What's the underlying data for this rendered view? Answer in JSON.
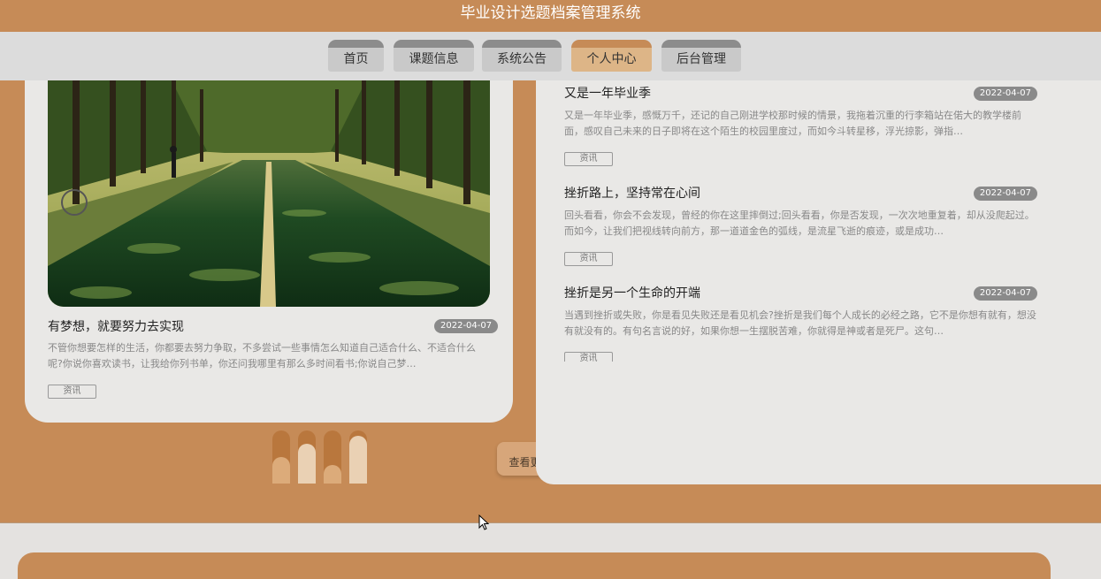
{
  "header": {
    "title": "毕业设计选题档案管理系统"
  },
  "nav": {
    "items": [
      {
        "label": "首页"
      },
      {
        "label": "课题信息"
      },
      {
        "label": "系统公告"
      },
      {
        "label": "个人中心"
      },
      {
        "label": "后台管理"
      }
    ],
    "active_index": 3
  },
  "featured": {
    "title": "有梦想，就要努力去实现",
    "date": "2022-04-07",
    "excerpt": "不管你想要怎样的生活，你都要去努力争取，不多尝试一些事情怎么知道自己适合什么、不适合什么呢?你说你喜欢读书，让我给你列书单，你还问我哪里有那么多时间看书;你说自己梦…",
    "tag": "资讯"
  },
  "news": [
    {
      "title": "又是一年毕业季",
      "date": "2022-04-07",
      "excerpt": "又是一年毕业季，感慨万千，还记的自己刚进学校那时候的情景，我拖着沉重的行李箱站在偌大的教学楼前面，感叹自己未来的日子即将在这个陌生的校园里度过，而如今斗转星移，浮光掠影，弹指…",
      "tag": "资讯"
    },
    {
      "title": "挫折路上，坚持常在心间",
      "date": "2022-04-07",
      "excerpt": "回头看看，你会不会发现，曾经的你在这里摔倒过;回头看看，你是否发现，一次次地重复着，却从没爬起过。而如今，让我们把视线转向前方，那一道道金色的弧线，是流星飞逝的痕迹，或是成功…",
      "tag": "资讯"
    },
    {
      "title": "挫折是另一个生命的开端",
      "date": "2022-04-07",
      "excerpt": "当遇到挫折或失败，你是看见失败还是看见机会?挫折是我们每个人成长的必经之路，它不是你想有就有，想没有就没有的。有句名言说的好，如果你想一生摆脱苦难，你就得是神或者是死尸。这句…",
      "tag": "资讯"
    }
  ],
  "pager": {
    "count": 4,
    "active": [
      false,
      true,
      false,
      true
    ],
    "fill_levels": [
      0.5,
      0.75,
      0.35,
      0.9
    ]
  },
  "more_button": {
    "label": "查看更多》"
  },
  "colors": {
    "accent": "#c68b57",
    "panel": "#e9e8e6",
    "badge": "#8a8a8a"
  },
  "icons": {
    "cursor": "cursor-arrow-icon"
  }
}
